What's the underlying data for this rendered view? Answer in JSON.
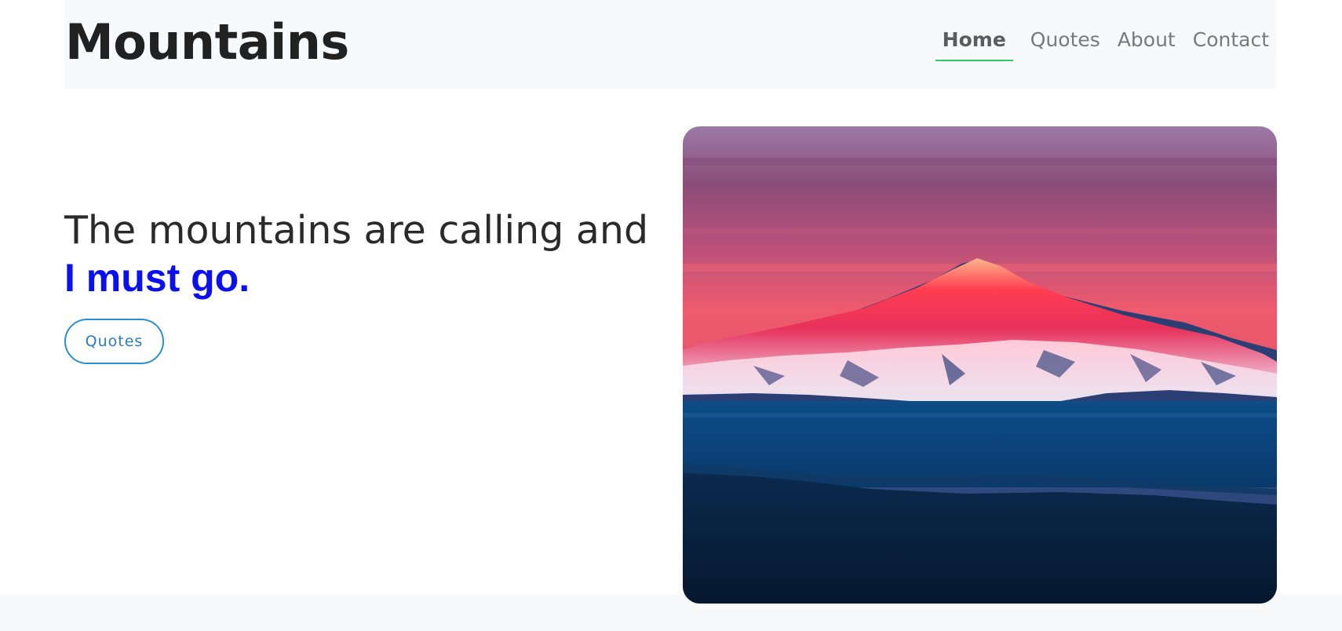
{
  "brand": "Mountains",
  "nav": {
    "items": [
      {
        "label": "Home",
        "active": true
      },
      {
        "label": "Quotes",
        "active": false
      },
      {
        "label": "About",
        "active": false
      },
      {
        "label": "Contact",
        "active": false
      }
    ]
  },
  "hero": {
    "headline_plain": "The mountains are calling and ",
    "headline_accent": "I must go.",
    "button_label": "Quotes"
  },
  "colors": {
    "accent_text": "#0a10f0",
    "nav_active_underline": "#35c45d",
    "button_border": "#2b8fd6",
    "navbar_bg": "#f8f9fa"
  }
}
